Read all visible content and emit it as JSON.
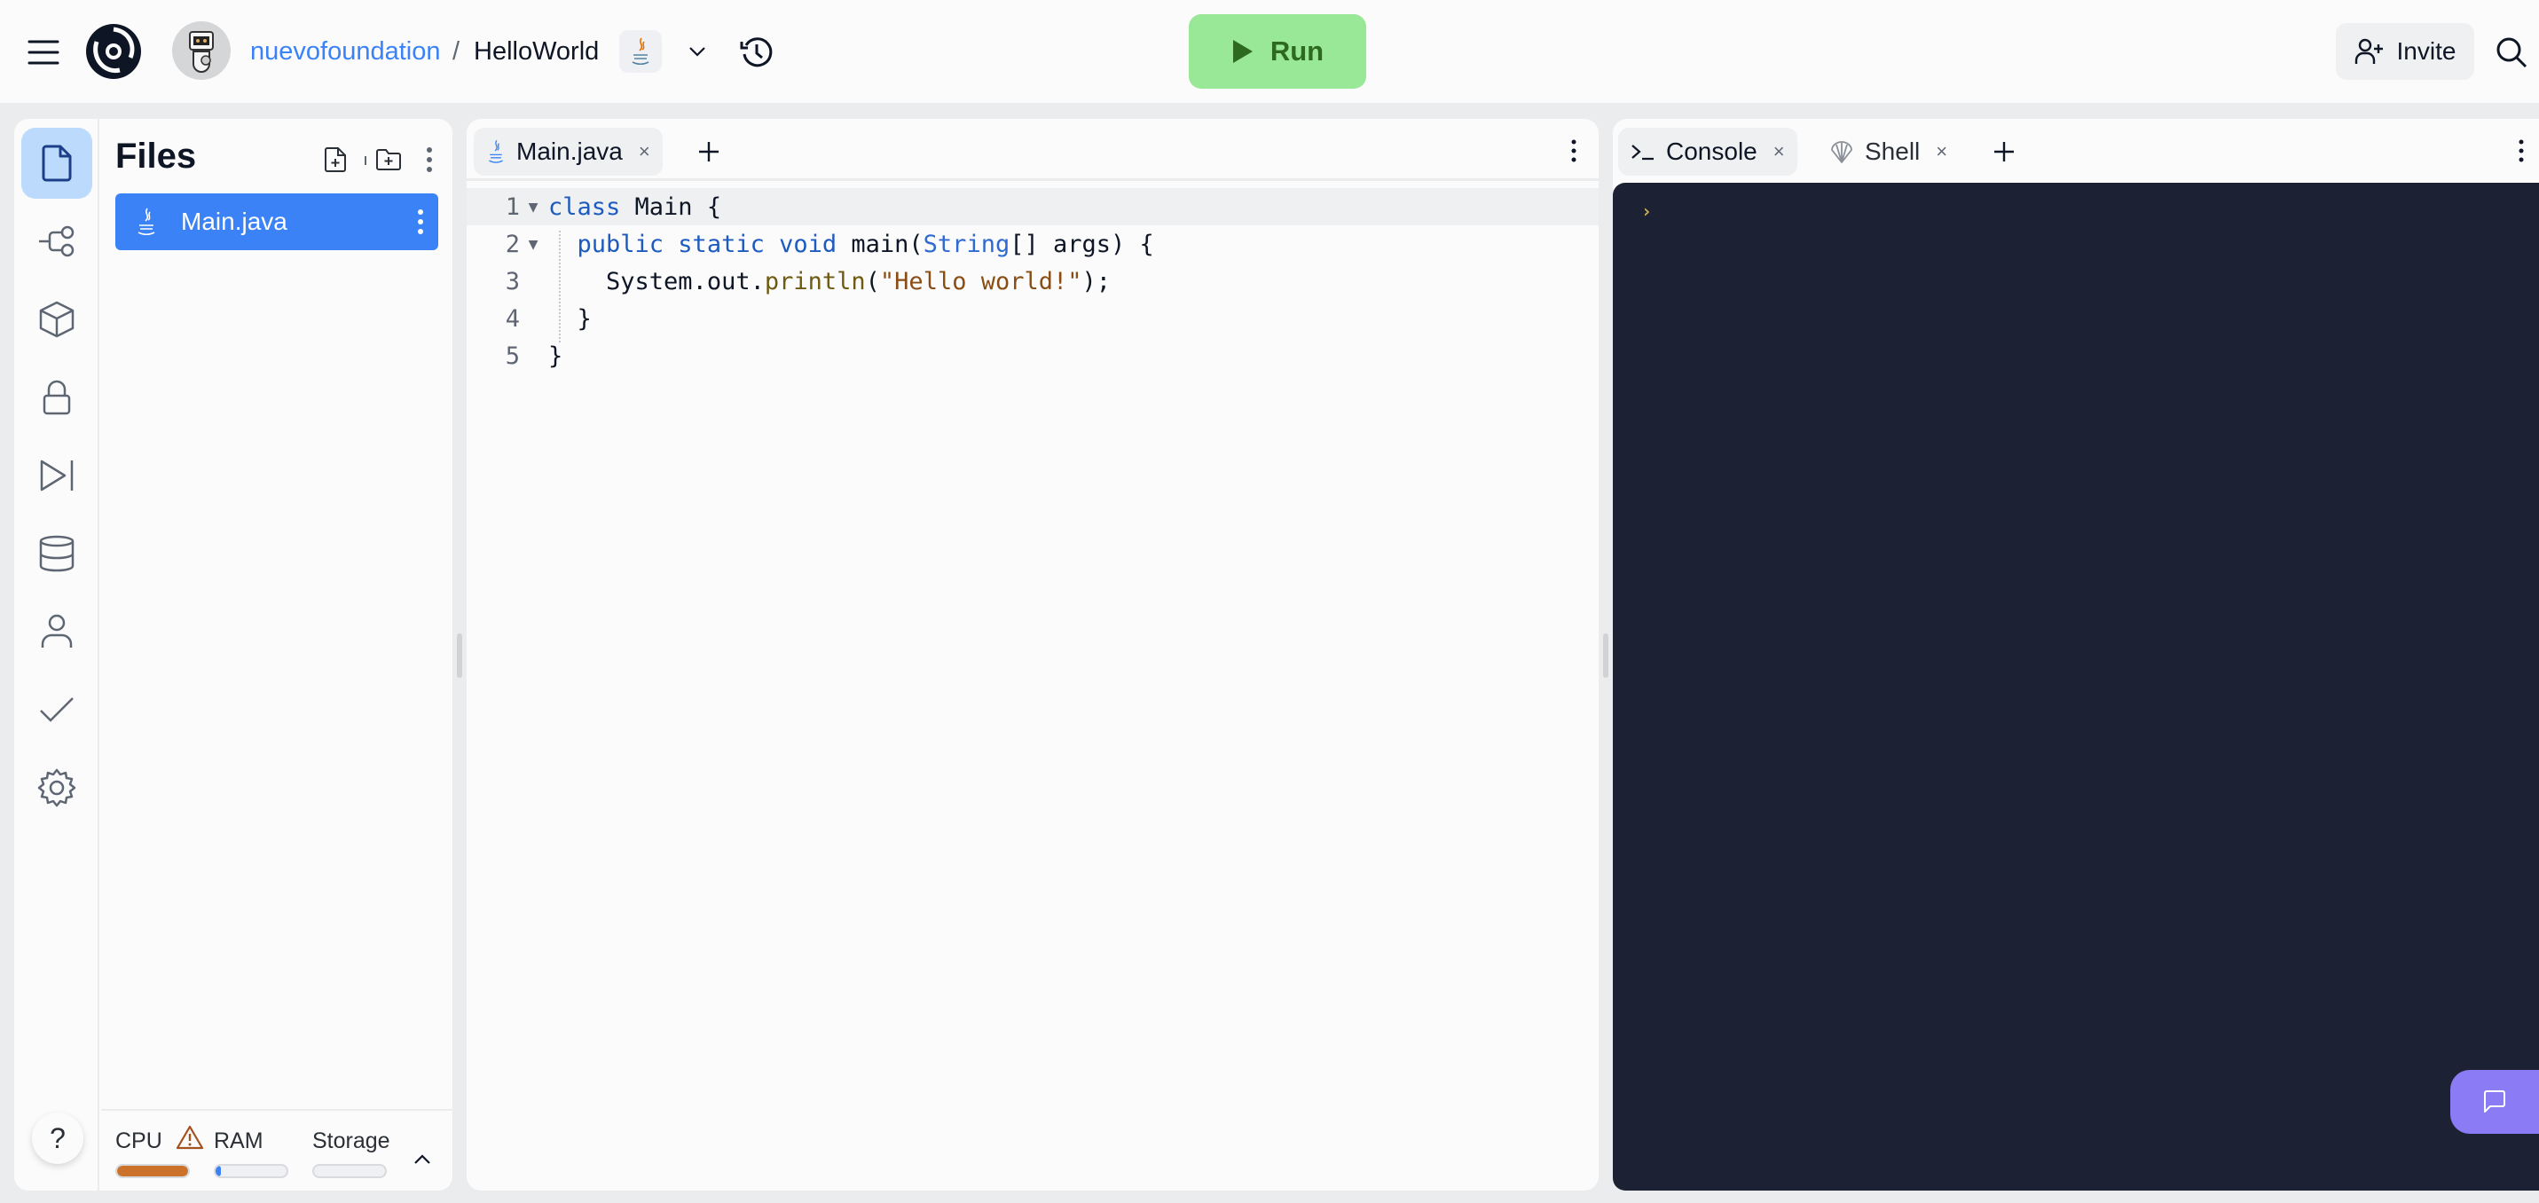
{
  "topbar": {
    "menu_icon": "hamburger-icon",
    "logo_icon": "replit-swirl-logo",
    "avatar_icon": "robot-avatar",
    "breadcrumb": {
      "owner": "nuevofoundation",
      "separator": "/",
      "repl_name": "HelloWorld"
    },
    "language_icon": "java-icon",
    "chevron_icon": "chevron-down-icon",
    "history_icon": "history-icon",
    "run_button": {
      "label": "Run",
      "icon": "play-icon",
      "color": "#98e898"
    },
    "invite_button": {
      "label": "Invite",
      "icon": "user-plus-icon"
    },
    "search_icon": "search-icon"
  },
  "sidebar": {
    "rail": [
      {
        "name": "files",
        "icon": "file-icon",
        "active": true
      },
      {
        "name": "git",
        "icon": "git-branch-icon"
      },
      {
        "name": "packages",
        "icon": "cube-icon"
      },
      {
        "name": "secrets",
        "icon": "lock-icon"
      },
      {
        "name": "debugger",
        "icon": "step-forward-icon"
      },
      {
        "name": "database",
        "icon": "database-icon"
      },
      {
        "name": "auth",
        "icon": "user-icon"
      },
      {
        "name": "tests",
        "icon": "check-icon"
      },
      {
        "name": "settings",
        "icon": "gear-icon"
      }
    ],
    "help_label": "?",
    "files": {
      "title": "Files",
      "items": [
        {
          "name": "Main.java",
          "icon": "java-icon",
          "selected": true
        }
      ]
    },
    "resources": {
      "cpu": {
        "label": "CPU",
        "warning": true,
        "usage_percent": 100,
        "color": "#cc7129"
      },
      "ram": {
        "label": "RAM",
        "usage_percent": 8,
        "color": "#3b82f6"
      },
      "storage": {
        "label": "Storage",
        "usage_percent": 0,
        "color": "#3b82f6"
      }
    }
  },
  "editor": {
    "tabs": [
      {
        "label": "Main.java",
        "icon": "java-icon",
        "active": true,
        "close": "×"
      }
    ],
    "lines": [
      {
        "num": "1",
        "fold": "▼"
      },
      {
        "num": "2",
        "fold": "▼"
      },
      {
        "num": "3",
        "fold": ""
      },
      {
        "num": "4",
        "fold": ""
      },
      {
        "num": "5",
        "fold": ""
      }
    ],
    "code": {
      "l1": {
        "kw": "class",
        "rest": " Main {"
      },
      "l2": {
        "indent": "  ",
        "kw": "public static void",
        "name": " main(",
        "type": "String",
        "rest": "[] args) {"
      },
      "l3": {
        "indent": "    ",
        "obj": "System.out",
        "dot": ".",
        "fn": "println",
        "open": "(",
        "str": "\"Hello world!\"",
        "close": ");"
      },
      "l4": {
        "text": "  }"
      },
      "l5": {
        "text": "}"
      }
    }
  },
  "console": {
    "tabs": [
      {
        "label": "Console",
        "icon": "terminal-icon",
        "active": true,
        "close": "×"
      },
      {
        "label": "Shell",
        "icon": "shell-icon",
        "active": false,
        "close": "×"
      }
    ],
    "prompt": "›",
    "feedback_icon": "chat-icon"
  }
}
